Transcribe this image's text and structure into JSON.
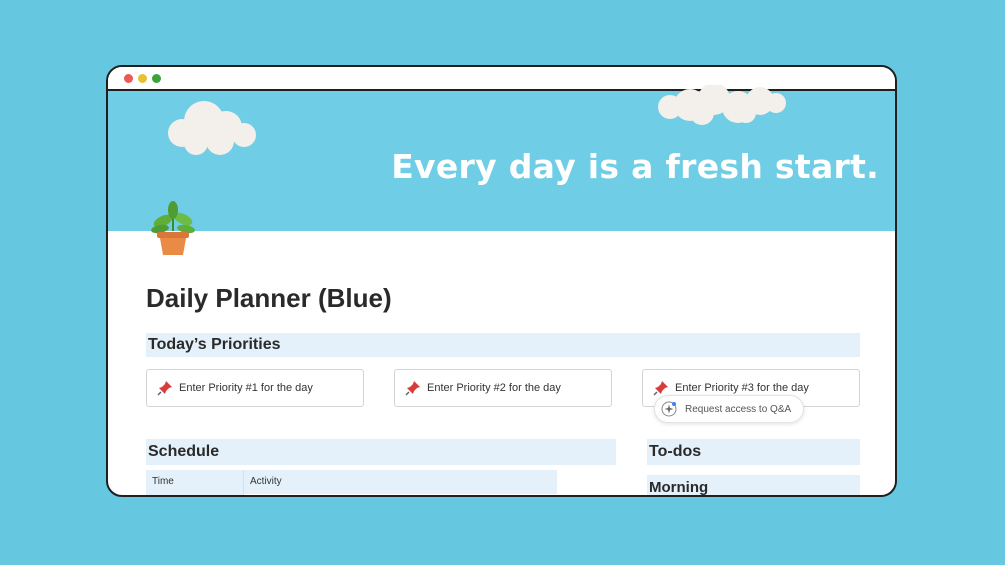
{
  "cover": {
    "tagline": "Every day is a fresh start."
  },
  "page": {
    "title": "Daily Planner (Blue)",
    "icon": "potted-plant-icon"
  },
  "priorities": {
    "heading": "Today’s Priorities",
    "items": [
      {
        "label": "Enter Priority #1 for the day",
        "icon": "pushpin-icon"
      },
      {
        "label": "Enter Priority #2 for the day",
        "icon": "pushpin-icon"
      },
      {
        "label": "Enter Priority #3 for the day",
        "icon": "pushpin-icon"
      }
    ]
  },
  "schedule": {
    "heading": "Schedule",
    "columns": [
      "Time",
      "Activity"
    ]
  },
  "todos": {
    "heading": "To-dos",
    "subheading": "Morning"
  },
  "qa_button": {
    "label": "Request access to Q&A",
    "icon": "sparkle-icon"
  },
  "colors": {
    "background": "#66c7e1",
    "cover": "#6fcde5",
    "section_band": "#e4f1fa"
  }
}
